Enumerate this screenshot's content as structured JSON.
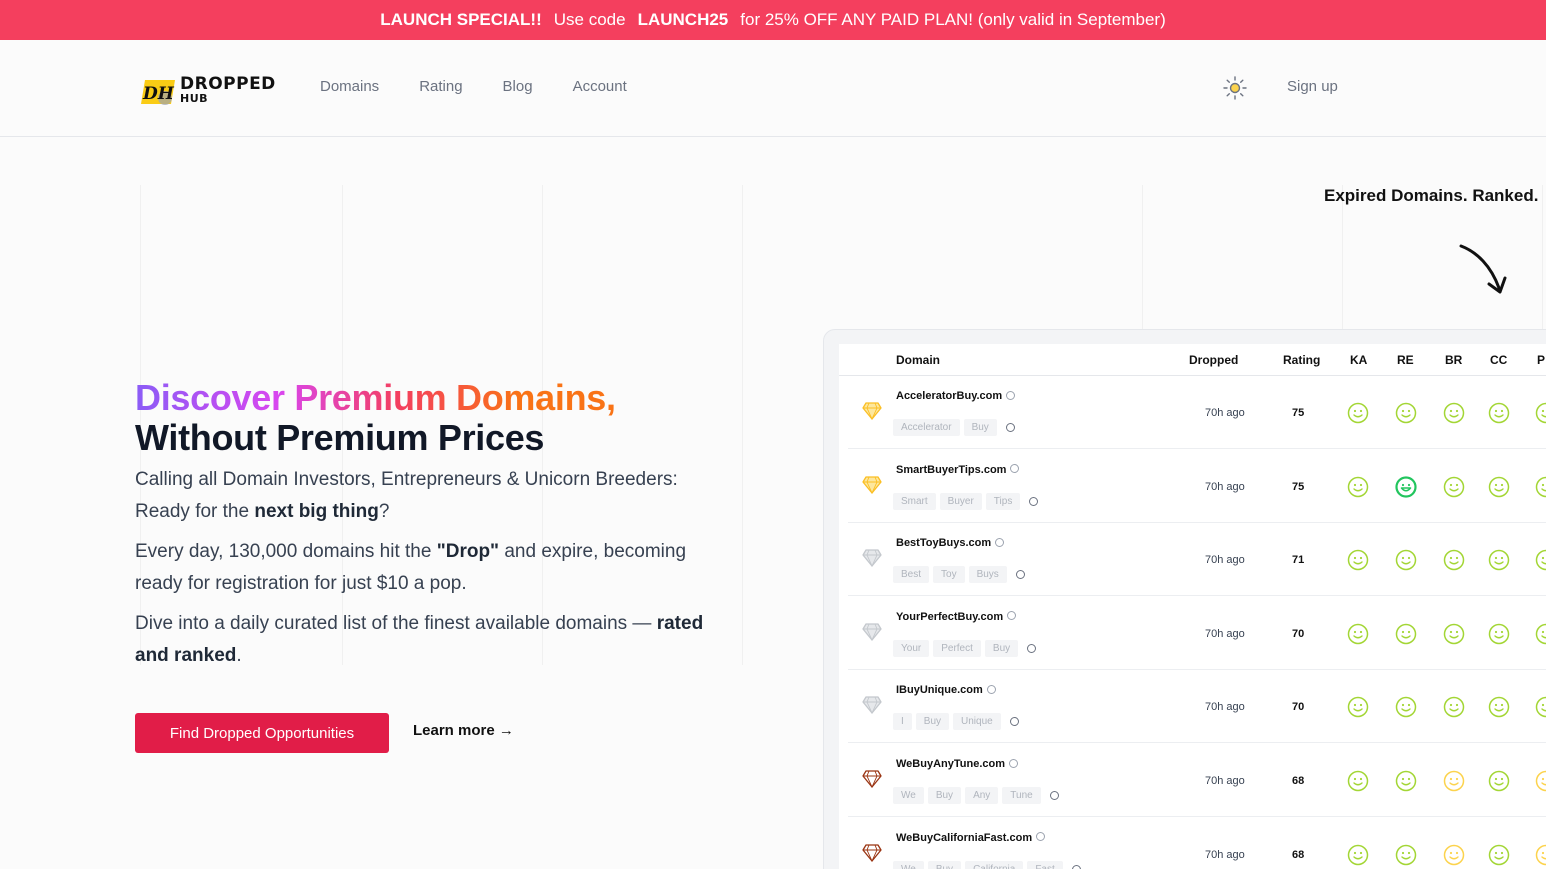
{
  "banner": {
    "title": "LAUNCH SPECIAL!!",
    "text1": "Use code",
    "code": "LAUNCH25",
    "text2": "for 25% OFF ANY PAID PLAN! (only valid in September)"
  },
  "logo": {
    "mark": "DH",
    "line1": "DROPPED",
    "line2": "HUB"
  },
  "nav": {
    "links": [
      "Domains",
      "Rating",
      "Blog",
      "Account"
    ],
    "signup": "Sign up"
  },
  "hero": {
    "title_gradient": "Discover Premium Domains,",
    "title_dark": "Without Premium Prices",
    "p1_a": "Calling all Domain Investors, Entrepreneurs & Unicorn Breeders: Ready for the ",
    "p1_b": "next big thing",
    "p1_c": "?",
    "p2_a": "Every day, 130,000 domains hit the ",
    "p2_b": "\"Drop\"",
    "p2_c": " and expire, becoming ready for registration for just $10 a pop.",
    "p3_a": "Dive into a daily curated list of the finest available domains — ",
    "p3_b": "rated and ranked",
    "p3_c": ".",
    "cta": "Find Dropped Opportunities",
    "learn_more": "Learn more →"
  },
  "annotation": "Expired Domains. Ranked.",
  "table": {
    "headers": {
      "domain": "Domain",
      "dropped": "Dropped",
      "rating": "Rating",
      "ka": "KA",
      "re": "RE",
      "br": "BR",
      "cc": "CC",
      "p": "P"
    },
    "rows": [
      {
        "domain": "AcceleratorBuy.com",
        "tags": [
          "Accelerator",
          "Buy"
        ],
        "dropped": "70h ago",
        "rating": "75",
        "gem": "gold",
        "faces": [
          "good",
          "good",
          "good",
          "good",
          "good"
        ]
      },
      {
        "domain": "SmartBuyerTips.com",
        "tags": [
          "Smart",
          "Buyer",
          "Tips"
        ],
        "dropped": "70h ago",
        "rating": "75",
        "gem": "gold",
        "faces": [
          "good",
          "great",
          "good",
          "good",
          "good"
        ]
      },
      {
        "domain": "BestToyBuys.com",
        "tags": [
          "Best",
          "Toy",
          "Buys"
        ],
        "dropped": "70h ago",
        "rating": "71",
        "gem": "silver",
        "faces": [
          "good",
          "good",
          "good",
          "good",
          "good"
        ]
      },
      {
        "domain": "YourPerfectBuy.com",
        "tags": [
          "Your",
          "Perfect",
          "Buy"
        ],
        "dropped": "70h ago",
        "rating": "70",
        "gem": "silver",
        "faces": [
          "good",
          "good",
          "good",
          "good",
          "good"
        ]
      },
      {
        "domain": "IBuyUnique.com",
        "tags": [
          "I",
          "Buy",
          "Unique"
        ],
        "dropped": "70h ago",
        "rating": "70",
        "gem": "silver",
        "faces": [
          "good",
          "good",
          "good",
          "good",
          "good"
        ]
      },
      {
        "domain": "WeBuyAnyTune.com",
        "tags": [
          "We",
          "Buy",
          "Any",
          "Tune"
        ],
        "dropped": "70h ago",
        "rating": "68",
        "gem": "bronze",
        "faces": [
          "good",
          "good",
          "ok",
          "good",
          "ok"
        ]
      },
      {
        "domain": "WeBuyCaliforniaFast.com",
        "tags": [
          "We",
          "Buy",
          "California",
          "Fast"
        ],
        "dropped": "70h ago",
        "rating": "68",
        "gem": "bronze",
        "faces": [
          "good",
          "good",
          "ok",
          "good",
          "ok"
        ]
      }
    ]
  },
  "colors": {
    "banner": "#f43f5e",
    "cta": "#e11d48",
    "face_good": "#a3d635",
    "face_great": "#22c55e",
    "face_ok": "#fcd34d",
    "gem_gold": "#fcd34d",
    "gem_silver": "#d1d5db",
    "gem_bronze": "#9a3412"
  },
  "icons": {
    "theme": "sun-icon",
    "arrow": "curved-arrow-icon",
    "gem": "diamond-icon",
    "face": "smiley-icon",
    "info": "info-circle-icon"
  }
}
